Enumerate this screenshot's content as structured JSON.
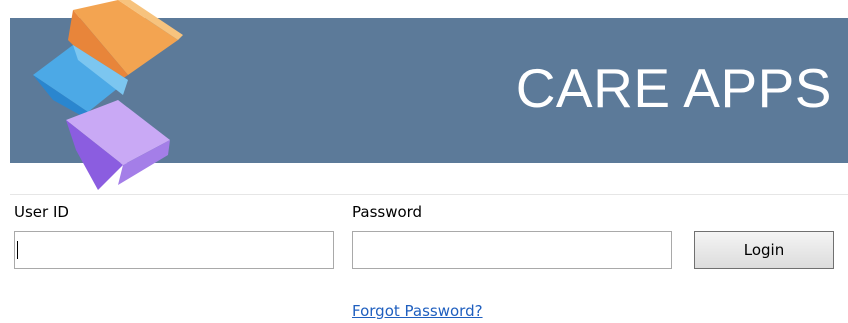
{
  "header": {
    "brand_title": "CARE APPS",
    "banner_color": "#5c7a99",
    "logo_icon": "stacked-cubes-logo"
  },
  "login_form": {
    "user_id": {
      "label": "User ID",
      "value": "",
      "placeholder": ""
    },
    "password": {
      "label": "Password",
      "value": "",
      "placeholder": ""
    },
    "login_button_label": "Login",
    "forgot_password_link": "Forgot Password?",
    "link_color": "#1f5fbf"
  }
}
